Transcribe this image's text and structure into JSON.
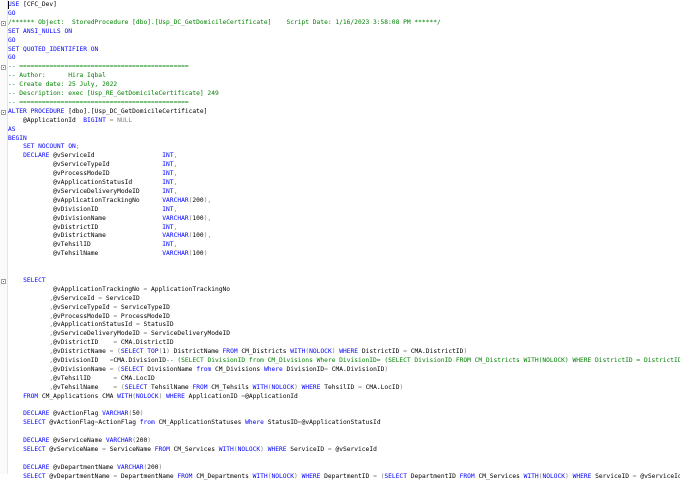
{
  "editor": {
    "lines": [
      [
        [
          "kw",
          "USE "
        ],
        [
          "t",
          "[CFC_Dev]"
        ]
      ],
      [
        [
          "kw",
          "GO"
        ]
      ],
      [
        [
          "cmt",
          "/****** Object:  StoredProcedure [dbo].[Usp_DC_GetDomicileCertificate]    Script Date: 1/16/2023 3:58:08 PM ******/"
        ]
      ],
      [
        [
          "kw",
          "SET ANSI_NULLS ON"
        ]
      ],
      [
        [
          "kw",
          "GO"
        ]
      ],
      [
        [
          "kw",
          "SET QUOTED_IDENTIFIER ON"
        ]
      ],
      [
        [
          "kw",
          "GO"
        ]
      ],
      [
        [
          "cmt",
          "-- ============================================="
        ]
      ],
      [
        [
          "cmt",
          "-- Author:      Hira Iqbal"
        ]
      ],
      [
        [
          "cmt",
          "-- Create date: 25 July, 2022"
        ]
      ],
      [
        [
          "cmt",
          "-- Description: exec [Usp_RE_GetDomicileCertificate] 249"
        ]
      ],
      [
        [
          "cmt",
          "-- ============================================="
        ]
      ],
      [
        [
          "kw",
          "ALTER PROCEDURE "
        ],
        [
          "t",
          "[dbo].[Usp_DC_GetDomicileCertificate]"
        ]
      ],
      [
        [
          "t",
          "    @ApplicationId  "
        ],
        [
          "kw",
          "BIGINT "
        ],
        [
          "op",
          "= "
        ],
        [
          "op",
          "NULL"
        ]
      ],
      [
        [
          "kw",
          "AS"
        ]
      ],
      [
        [
          "kw",
          "BEGIN"
        ]
      ],
      [
        [
          "t",
          "    "
        ],
        [
          "kw",
          "SET NOCOUNT ON"
        ],
        [
          "op",
          ";"
        ]
      ],
      [
        [
          "t",
          "    "
        ],
        [
          "kw",
          "DECLARE "
        ],
        [
          "t",
          "@vServiceId                  "
        ],
        [
          "kw",
          "INT"
        ],
        [
          "op",
          ","
        ]
      ],
      [
        [
          "t",
          "            @vServiceTypeId              "
        ],
        [
          "kw",
          "INT"
        ],
        [
          "op",
          ","
        ]
      ],
      [
        [
          "t",
          "            @vProcessModeID              "
        ],
        [
          "kw",
          "INT"
        ],
        [
          "op",
          ","
        ]
      ],
      [
        [
          "t",
          "            @vApplicationStatusId        "
        ],
        [
          "kw",
          "INT"
        ],
        [
          "op",
          ","
        ]
      ],
      [
        [
          "t",
          "            @vServiceDeliveryModeID      "
        ],
        [
          "kw",
          "INT"
        ],
        [
          "op",
          ","
        ]
      ],
      [
        [
          "t",
          "            @vApplicationTrackingNo      "
        ],
        [
          "kw",
          "VARCHAR"
        ],
        [
          "op",
          "("
        ],
        [
          "t",
          "200"
        ],
        [
          "op",
          "),"
        ]
      ],
      [
        [
          "t",
          "            @vDivisionID                 "
        ],
        [
          "kw",
          "INT"
        ],
        [
          "op",
          ","
        ]
      ],
      [
        [
          "t",
          "            @vDivisionName               "
        ],
        [
          "kw",
          "VARCHAR"
        ],
        [
          "op",
          "("
        ],
        [
          "t",
          "100"
        ],
        [
          "op",
          "),"
        ]
      ],
      [
        [
          "t",
          "            @vDistrictID                 "
        ],
        [
          "kw",
          "INT"
        ],
        [
          "op",
          ","
        ]
      ],
      [
        [
          "t",
          "            @vDistrictName               "
        ],
        [
          "kw",
          "VARCHAR"
        ],
        [
          "op",
          "("
        ],
        [
          "t",
          "100"
        ],
        [
          "op",
          "),"
        ]
      ],
      [
        [
          "t",
          "            @vTehsilID                   "
        ],
        [
          "kw",
          "INT"
        ],
        [
          "op",
          ","
        ]
      ],
      [
        [
          "t",
          "            @vTehsilName                 "
        ],
        [
          "kw",
          "VARCHAR"
        ],
        [
          "op",
          "("
        ],
        [
          "t",
          "100"
        ],
        [
          "op",
          ")"
        ]
      ],
      [],
      [],
      [
        [
          "t",
          "    "
        ],
        [
          "kw",
          "SELECT"
        ]
      ],
      [
        [
          "t",
          "            @vApplicationTrackingNo "
        ],
        [
          "op",
          "= "
        ],
        [
          "t",
          "ApplicationTrackingNo"
        ]
      ],
      [
        [
          "t",
          "           "
        ],
        [
          "op",
          ","
        ],
        [
          "t",
          "@vServiceId "
        ],
        [
          "op",
          "= "
        ],
        [
          "t",
          "ServiceID"
        ]
      ],
      [
        [
          "t",
          "           "
        ],
        [
          "op",
          ","
        ],
        [
          "t",
          "@vServiceTypeId "
        ],
        [
          "op",
          "= "
        ],
        [
          "t",
          "ServiceTypeID"
        ]
      ],
      [
        [
          "t",
          "           "
        ],
        [
          "op",
          ","
        ],
        [
          "t",
          "@vProcessModeID "
        ],
        [
          "op",
          "= "
        ],
        [
          "t",
          "ProcessModeID"
        ]
      ],
      [
        [
          "t",
          "           "
        ],
        [
          "op",
          ","
        ],
        [
          "t",
          "@vApplicationStatusId "
        ],
        [
          "op",
          "= "
        ],
        [
          "t",
          "StatusID"
        ]
      ],
      [
        [
          "t",
          "           "
        ],
        [
          "op",
          ","
        ],
        [
          "t",
          "@vServiceDeliveryModeID "
        ],
        [
          "op",
          "= "
        ],
        [
          "t",
          "ServiceDeliveryModeID"
        ]
      ],
      [
        [
          "t",
          "           "
        ],
        [
          "op",
          ","
        ],
        [
          "t",
          "@vDistrictID    "
        ],
        [
          "op",
          "= "
        ],
        [
          "t",
          "CMA.DistrictID"
        ]
      ],
      [
        [
          "t",
          "           "
        ],
        [
          "op",
          ","
        ],
        [
          "t",
          "@vDistrictName "
        ],
        [
          "op",
          "= ("
        ],
        [
          "kw",
          "SELECT TOP"
        ],
        [
          "op",
          "("
        ],
        [
          "t",
          "1"
        ],
        [
          "op",
          ") "
        ],
        [
          "t",
          "DistrictName "
        ],
        [
          "kw",
          "FROM "
        ],
        [
          "t",
          "CM_Districts "
        ],
        [
          "kw",
          "WITH"
        ],
        [
          "op",
          "("
        ],
        [
          "kw",
          "NOLOCK"
        ],
        [
          "op",
          ") "
        ],
        [
          "kw",
          "WHERE "
        ],
        [
          "t",
          "DistrictID "
        ],
        [
          "op",
          "= "
        ],
        [
          "t",
          "CMA.DistrictID"
        ],
        [
          "op",
          ")"
        ]
      ],
      [
        [
          "t",
          "           "
        ],
        [
          "op",
          ","
        ],
        [
          "t",
          "@vDivisionID   "
        ],
        [
          "op",
          "="
        ],
        [
          "t",
          "CMA.DivisionID"
        ],
        [
          "cmt",
          "-- (SELECT DivisionID from CM_Divisions Where DivisionID= (SELECT DivisionID FROM CM_Districts WITH(NOLOCK) WHERE DistrictID = DistrictID))"
        ]
      ],
      [
        [
          "t",
          "           "
        ],
        [
          "op",
          ","
        ],
        [
          "t",
          "@vDivisionName "
        ],
        [
          "op",
          "= ("
        ],
        [
          "kw",
          "SELECT "
        ],
        [
          "t",
          "DivisionName "
        ],
        [
          "kw",
          "from "
        ],
        [
          "t",
          "CM_Divisions "
        ],
        [
          "kw",
          "Where "
        ],
        [
          "t",
          "DivisionID"
        ],
        [
          "op",
          "= "
        ],
        [
          "t",
          "CMA.DivisionID"
        ],
        [
          "op",
          ")"
        ]
      ],
      [
        [
          "t",
          "           "
        ],
        [
          "op",
          ","
        ],
        [
          "t",
          "@vTehsilID      "
        ],
        [
          "op",
          "= "
        ],
        [
          "t",
          "CMA.LocID"
        ]
      ],
      [
        [
          "t",
          "           "
        ],
        [
          "op",
          ","
        ],
        [
          "t",
          "@vTehsilName    "
        ],
        [
          "op",
          "= ("
        ],
        [
          "kw",
          "SELECT "
        ],
        [
          "t",
          "TehsilName "
        ],
        [
          "kw",
          "FROM "
        ],
        [
          "t",
          "CM_Tehsils "
        ],
        [
          "kw",
          "WITH"
        ],
        [
          "op",
          "("
        ],
        [
          "kw",
          "NOLOCK"
        ],
        [
          "op",
          ") "
        ],
        [
          "kw",
          "WHERE "
        ],
        [
          "t",
          "TehsilID "
        ],
        [
          "op",
          "= "
        ],
        [
          "t",
          "CMA.LocID"
        ],
        [
          "op",
          ")"
        ]
      ],
      [
        [
          "t",
          "    "
        ],
        [
          "kw",
          "FROM "
        ],
        [
          "t",
          "CM_Applications CMA "
        ],
        [
          "kw",
          "WITH"
        ],
        [
          "op",
          "("
        ],
        [
          "kw",
          "NOLOCK"
        ],
        [
          "op",
          ") "
        ],
        [
          "kw",
          "WHERE "
        ],
        [
          "t",
          "ApplicationID "
        ],
        [
          "op",
          "="
        ],
        [
          "t",
          "@ApplicationId"
        ]
      ],
      [],
      [
        [
          "t",
          "    "
        ],
        [
          "kw",
          "DECLARE "
        ],
        [
          "t",
          "@vActionFlag "
        ],
        [
          "kw",
          "VARCHAR"
        ],
        [
          "op",
          "("
        ],
        [
          "t",
          "50"
        ],
        [
          "op",
          ")"
        ]
      ],
      [
        [
          "t",
          "    "
        ],
        [
          "kw",
          "SELECT "
        ],
        [
          "t",
          "@vActionFlag"
        ],
        [
          "op",
          "="
        ],
        [
          "t",
          "ActionFlag "
        ],
        [
          "kw",
          "from "
        ],
        [
          "t",
          "CM_ApplicationStatuses "
        ],
        [
          "kw",
          "Where "
        ],
        [
          "t",
          "StatusID"
        ],
        [
          "op",
          "="
        ],
        [
          "t",
          "@vApplicationStatusId"
        ]
      ],
      [],
      [
        [
          "t",
          "    "
        ],
        [
          "kw",
          "DECLARE "
        ],
        [
          "t",
          "@vServiceName "
        ],
        [
          "kw",
          "VARCHAR"
        ],
        [
          "op",
          "("
        ],
        [
          "t",
          "200"
        ],
        [
          "op",
          ")"
        ]
      ],
      [
        [
          "t",
          "    "
        ],
        [
          "kw",
          "SELECT "
        ],
        [
          "t",
          "@vServiceName "
        ],
        [
          "op",
          "= "
        ],
        [
          "t",
          "ServiceName "
        ],
        [
          "kw",
          "FROM "
        ],
        [
          "t",
          "CM_Services "
        ],
        [
          "kw",
          "WITH"
        ],
        [
          "op",
          "("
        ],
        [
          "kw",
          "NOLOCK"
        ],
        [
          "op",
          ") "
        ],
        [
          "kw",
          "WHERE "
        ],
        [
          "t",
          "ServiceID "
        ],
        [
          "op",
          "= "
        ],
        [
          "t",
          "@vServiceId"
        ]
      ],
      [],
      [
        [
          "t",
          "    "
        ],
        [
          "kw",
          "DECLARE "
        ],
        [
          "t",
          "@vDepartmentName "
        ],
        [
          "kw",
          "VARCHAR"
        ],
        [
          "op",
          "("
        ],
        [
          "t",
          "200"
        ],
        [
          "op",
          ")"
        ]
      ],
      [
        [
          "t",
          "    "
        ],
        [
          "kw",
          "SELECT "
        ],
        [
          "t",
          "@vDepartmentName "
        ],
        [
          "op",
          "= "
        ],
        [
          "t",
          "DepartmentName "
        ],
        [
          "kw",
          "FROM "
        ],
        [
          "t",
          "CM_Departments "
        ],
        [
          "kw",
          "WITH"
        ],
        [
          "op",
          "("
        ],
        [
          "kw",
          "NOLOCK"
        ],
        [
          "op",
          ") "
        ],
        [
          "kw",
          "WHERE "
        ],
        [
          "t",
          "DepartmentID "
        ],
        [
          "op",
          "= ("
        ],
        [
          "kw",
          "SELECT "
        ],
        [
          "t",
          "DepartmentID "
        ],
        [
          "kw",
          "FROM "
        ],
        [
          "t",
          "CM_Services "
        ],
        [
          "kw",
          "WITH"
        ],
        [
          "op",
          "("
        ],
        [
          "kw",
          "NOLOCK"
        ],
        [
          "op",
          ") "
        ],
        [
          "kw",
          "WHERE "
        ],
        [
          "t",
          "ServiceID "
        ],
        [
          "op",
          "= "
        ],
        [
          "t",
          "@vServiceId "
        ],
        [
          "op",
          ")"
        ]
      ]
    ],
    "fold_markers_at_lines": [
      2,
      7,
      12,
      31
    ]
  }
}
